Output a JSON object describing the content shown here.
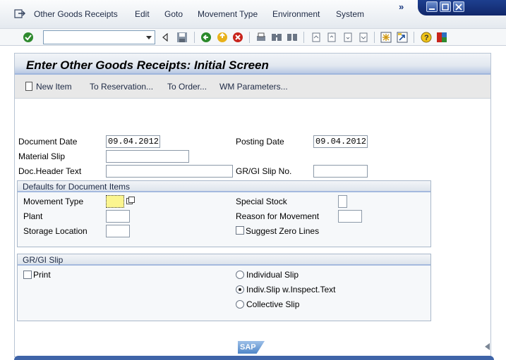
{
  "menu": {
    "items": [
      "Other Goods Receipts",
      "Edit",
      "Goto",
      "Movement Type",
      "Environment",
      "System"
    ],
    "more": "»"
  },
  "toolbar": {
    "command_field_value": ""
  },
  "screen": {
    "title": "Enter Other Goods Receipts: Initial Screen",
    "app_buttons": [
      "New Item",
      "To Reservation...",
      "To Order...",
      "WM Parameters..."
    ]
  },
  "form": {
    "document_date_label": "Document Date",
    "document_date_value": "09.04.2012",
    "posting_date_label": "Posting Date",
    "posting_date_value": "09.04.2012",
    "material_slip_label": "Material Slip",
    "material_slip_value": "",
    "doc_header_text_label": "Doc.Header Text",
    "doc_header_text_value": "",
    "grgi_slip_no_label": "GR/GI Slip No.",
    "grgi_slip_no_value": ""
  },
  "defaults_group": {
    "title": "Defaults for Document Items",
    "movement_type_label": "Movement Type",
    "movement_type_value": "",
    "plant_label": "Plant",
    "plant_value": "",
    "storage_location_label": "Storage Location",
    "storage_location_value": "",
    "special_stock_label": "Special Stock",
    "special_stock_value": "",
    "reason_for_movement_label": "Reason for Movement",
    "reason_for_movement_value": "",
    "suggest_zero_lines_label": "Suggest Zero Lines",
    "suggest_zero_lines_checked": false
  },
  "slip_group": {
    "title": "GR/GI Slip",
    "print_label": "Print",
    "print_checked": false,
    "options": [
      {
        "label": "Individual Slip",
        "selected": false
      },
      {
        "label": "Indiv.Slip w.Inspect.Text",
        "selected": true
      },
      {
        "label": "Collective Slip",
        "selected": false
      }
    ]
  },
  "footer": {
    "logo_text": "SAP"
  }
}
